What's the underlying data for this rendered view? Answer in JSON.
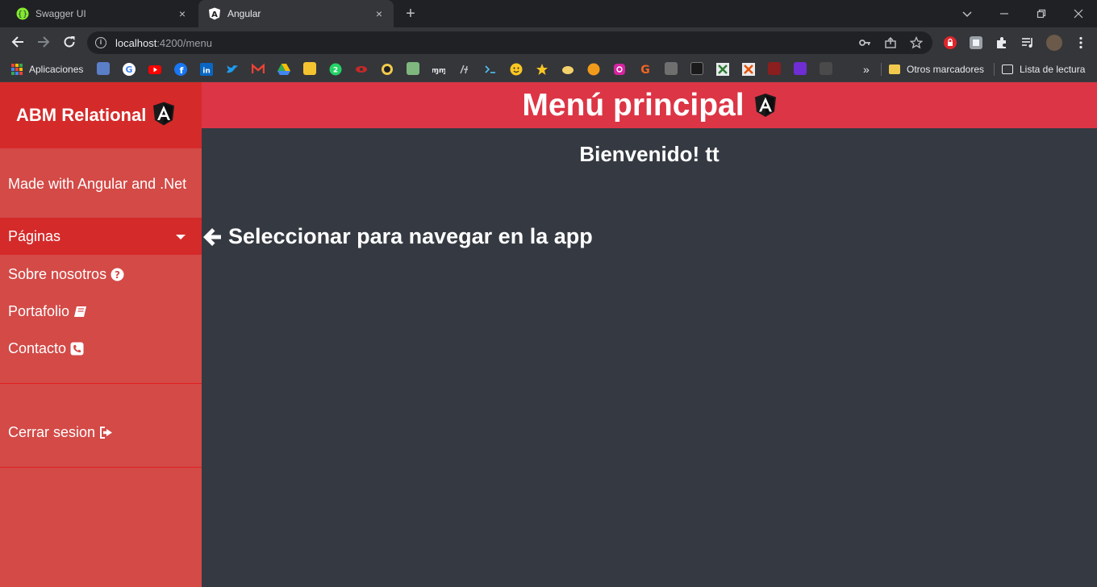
{
  "browser": {
    "tabs": [
      {
        "title": "Swagger UI",
        "active": false
      },
      {
        "title": "Angular",
        "active": true
      }
    ],
    "new_tab": "+",
    "url_host": "localhost",
    "url_rest": ":4200/menu",
    "controls": {
      "close": "×"
    },
    "bookmarks": {
      "apps_label": "Aplicaciones",
      "overflow": "»",
      "other_label": "Otros marcadores",
      "reading_label": "Lista de lectura"
    }
  },
  "sidebar": {
    "brand": "ABM Relational",
    "tagline": "Made with Angular and .Net",
    "section": "Páginas",
    "links": [
      {
        "label": "Sobre nosotros",
        "icon": "question-circle-icon"
      },
      {
        "label": "Portafolio",
        "icon": "book-icon"
      },
      {
        "label": "Contacto",
        "icon": "phone-square-icon"
      }
    ],
    "logout": "Cerrar sesion"
  },
  "main": {
    "title": "Menú principal",
    "welcome": "Bienvenido! tt",
    "hint": "Seleccionar para navegar en la app"
  },
  "colors": {
    "header_red": "#dc3545",
    "sidebar_red": "#d34a47",
    "sidebar_dark_red": "#d52a2a",
    "content_bg": "#353a42"
  }
}
